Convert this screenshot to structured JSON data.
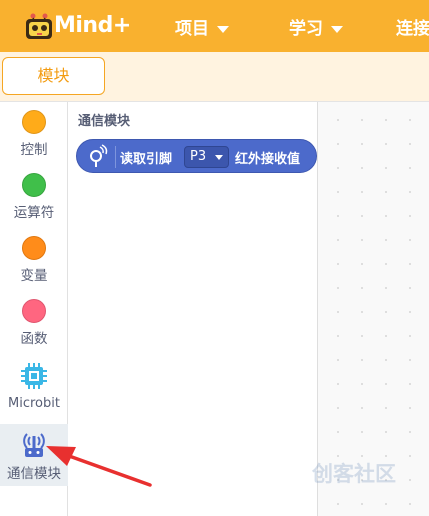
{
  "app": {
    "logo_text": "Mind+"
  },
  "nav": [
    {
      "label": "项目",
      "has_caret": true
    },
    {
      "label": "学习",
      "has_caret": true
    },
    {
      "label": "连接"
    }
  ],
  "tabs": {
    "active_label": "模块"
  },
  "categories": [
    {
      "label": "控制",
      "color": "#ffab19"
    },
    {
      "label": "运算符",
      "color": "#40bf4a"
    },
    {
      "label": "变量",
      "color": "#ff8c1a"
    },
    {
      "label": "函数",
      "color": "#ff6680"
    },
    {
      "label": "Microbit",
      "icon": "microbit-chip-icon",
      "color": "#3ab7e6"
    },
    {
      "label": "通信模块",
      "icon": "ir-remote-icon",
      "color": "#4c6acb",
      "selected": true
    }
  ],
  "flyout": {
    "title": "通信模块",
    "block": {
      "icon": "ir-receiver-icon",
      "text_before": "读取引脚",
      "pin_value": "P3",
      "text_after": "红外接收值",
      "color": "#4c6acb"
    }
  },
  "watermark": {
    "text": "创客社区"
  },
  "annotation": {
    "arrow_color": "#e8302f"
  }
}
